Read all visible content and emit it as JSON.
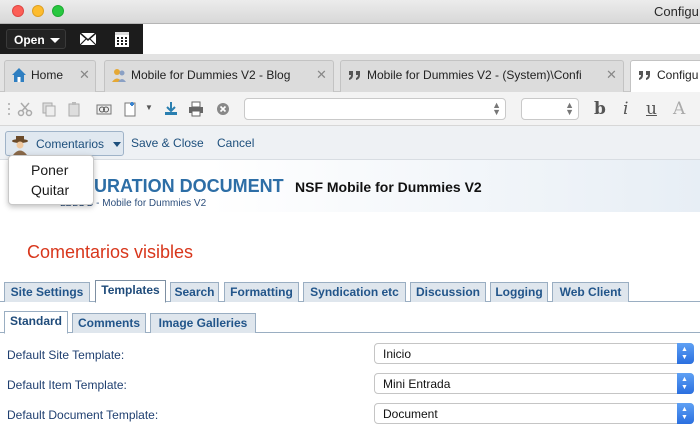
{
  "window": {
    "title": "Configu"
  },
  "toolbar": {
    "open_label": "Open"
  },
  "app_tabs": [
    {
      "label": "Home"
    },
    {
      "label": "Mobile for Dummies V2 - Blog"
    },
    {
      "label": "Mobile for Dummies V2 - (System)\\Confi"
    },
    {
      "label": "Configu"
    }
  ],
  "action_bar": {
    "comentarios_label": "Comentarios",
    "save_close_label": "Save & Close",
    "cancel_label": "Cancel"
  },
  "dropdown": {
    "items": [
      "Poner",
      "Quitar"
    ]
  },
  "document": {
    "title_main": "URATION DOCUMENT",
    "title_db": "NSF Mobile for Dummies V2",
    "breadcrumb": "LBLOG - Mobile for Dummies V2"
  },
  "section": {
    "title": "Comentarios visibles"
  },
  "main_tabs": [
    "Site Settings",
    "Templates",
    "Search",
    "Formatting",
    "Syndication etc",
    "Discussion",
    "Logging",
    "Web Client"
  ],
  "sub_tabs": [
    "Standard",
    "Comments",
    "Image Galleries"
  ],
  "fields": [
    {
      "label": "Default Site Template:",
      "value": "Inicio"
    },
    {
      "label": "Default Item Template:",
      "value": "Mini Entrada"
    },
    {
      "label": "Default Document Template:",
      "value": "Document"
    }
  ],
  "colors": {
    "accent": "#2d6ea6",
    "section_title": "#d8361b",
    "link": "#1d4f7c"
  }
}
